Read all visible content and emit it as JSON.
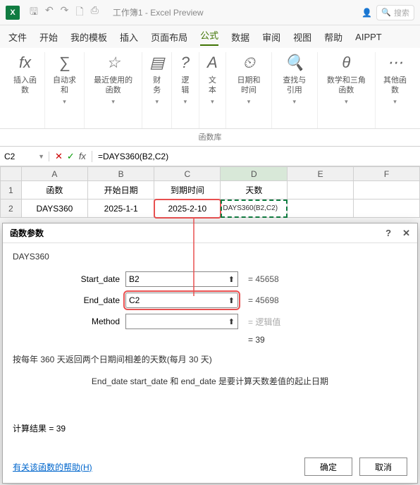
{
  "titlebar": {
    "app_letter": "X",
    "title": "工作簿1 - Excel Preview",
    "search_placeholder": "搜索",
    "account_icon": "👤"
  },
  "menu": {
    "items": [
      "文件",
      "开始",
      "我的模板",
      "插入",
      "页面布局",
      "公式",
      "数据",
      "审阅",
      "视图",
      "帮助",
      "AIPPT"
    ],
    "active_index": 5
  },
  "ribbon": {
    "groups": [
      {
        "icon": "fx",
        "label": "插入函数",
        "arrow": false
      },
      {
        "icon": "∑",
        "label": "自动求和",
        "arrow": true
      },
      {
        "icon": "☆",
        "label": "最近使用的函数",
        "arrow": true
      },
      {
        "icon": "▤",
        "label": "财务",
        "arrow": true
      },
      {
        "icon": "?",
        "label": "逻辑",
        "arrow": true
      },
      {
        "icon": "A",
        "label": "文本",
        "arrow": true
      },
      {
        "icon": "⏲",
        "label": "日期和时间",
        "arrow": true
      },
      {
        "icon": "🔍",
        "label": "查找与引用",
        "arrow": true
      },
      {
        "icon": "θ",
        "label": "数学和三角函数",
        "arrow": true
      },
      {
        "icon": "⋯",
        "label": "其他函数",
        "arrow": true
      }
    ],
    "group_name": "函数库"
  },
  "formula_bar": {
    "namebox": "C2",
    "formula": "=DAYS360(B2,C2)"
  },
  "grid": {
    "cols": [
      "A",
      "B",
      "C",
      "D",
      "E",
      "F"
    ],
    "rows": [
      {
        "n": "1",
        "cells": [
          "函数",
          "开始日期",
          "到期时间",
          "天数",
          "",
          ""
        ]
      },
      {
        "n": "2",
        "cells": [
          "DAYS360",
          "2025-1-1",
          "2025-2-10",
          "DAYS360(B2,C2)",
          "",
          ""
        ]
      }
    ]
  },
  "dialog": {
    "title": "函数参数",
    "fname": "DAYS360",
    "params": [
      {
        "label": "Start_date",
        "value": "B2",
        "result": "= 45658"
      },
      {
        "label": "End_date",
        "value": "C2",
        "result": "= 45698"
      },
      {
        "label": "Method",
        "value": "",
        "result": "= 逻辑值"
      }
    ],
    "result_eq": "= 39",
    "desc1": "按每年 360 天返回两个日期间相差的天数(每月 30 天)",
    "desc2": "End_date  start_date 和 end_date 是要计算天数差值的起止日期",
    "calc_result_label": "计算结果 = ",
    "calc_result_value": "39",
    "help_link": "有关该函数的帮助(H)",
    "ok": "确定",
    "cancel": "取消"
  }
}
